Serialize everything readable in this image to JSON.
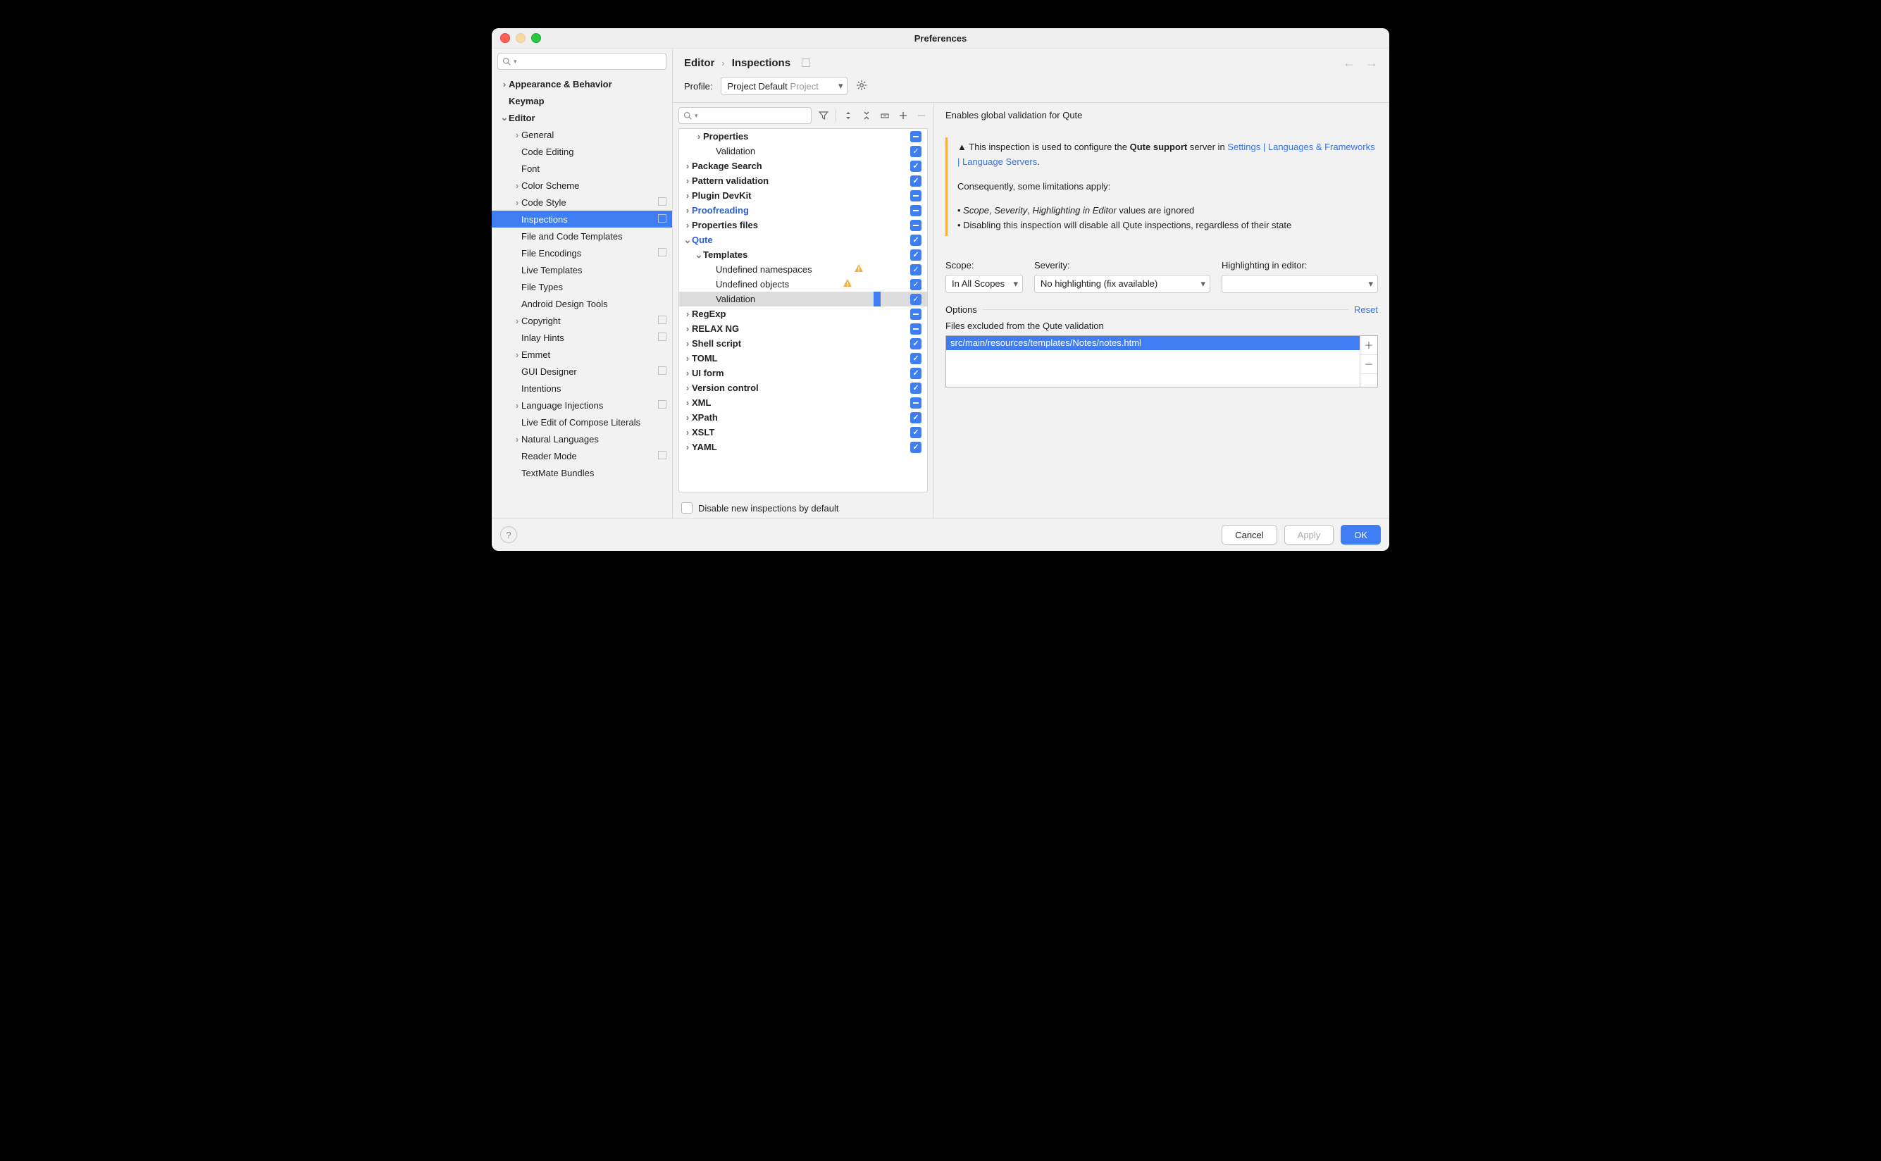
{
  "title": "Preferences",
  "breadcrumb": [
    "Editor",
    "Inspections"
  ],
  "profile_label": "Profile:",
  "profile_value": "Project Default",
  "profile_scope": "Project",
  "sidebar": [
    {
      "label": "Appearance & Behavior",
      "depth": 0,
      "arrow": "right",
      "bold": true
    },
    {
      "label": "Keymap",
      "depth": 0,
      "bold": true
    },
    {
      "label": "Editor",
      "depth": 0,
      "arrow": "down",
      "bold": true
    },
    {
      "label": "General",
      "depth": 1,
      "arrow": "right"
    },
    {
      "label": "Code Editing",
      "depth": 1
    },
    {
      "label": "Font",
      "depth": 1
    },
    {
      "label": "Color Scheme",
      "depth": 1,
      "arrow": "right"
    },
    {
      "label": "Code Style",
      "depth": 1,
      "arrow": "right",
      "dots": true
    },
    {
      "label": "Inspections",
      "depth": 1,
      "sel": true,
      "dots": true
    },
    {
      "label": "File and Code Templates",
      "depth": 1
    },
    {
      "label": "File Encodings",
      "depth": 1,
      "dots": true
    },
    {
      "label": "Live Templates",
      "depth": 1
    },
    {
      "label": "File Types",
      "depth": 1
    },
    {
      "label": "Android Design Tools",
      "depth": 1
    },
    {
      "label": "Copyright",
      "depth": 1,
      "arrow": "right",
      "dots": true
    },
    {
      "label": "Inlay Hints",
      "depth": 1,
      "dots": true
    },
    {
      "label": "Emmet",
      "depth": 1,
      "arrow": "right"
    },
    {
      "label": "GUI Designer",
      "depth": 1,
      "dots": true
    },
    {
      "label": "Intentions",
      "depth": 1
    },
    {
      "label": "Language Injections",
      "depth": 1,
      "arrow": "right",
      "dots": true
    },
    {
      "label": "Live Edit of Compose Literals",
      "depth": 1
    },
    {
      "label": "Natural Languages",
      "depth": 1,
      "arrow": "right"
    },
    {
      "label": "Reader Mode",
      "depth": 1,
      "dots": true
    },
    {
      "label": "TextMate Bundles",
      "depth": 1
    }
  ],
  "inspections": [
    {
      "label": "Properties",
      "depth": 1,
      "arrow": "right",
      "bold": true,
      "state": "mix"
    },
    {
      "label": "Validation",
      "depth": 2,
      "state": "on"
    },
    {
      "label": "Package Search",
      "depth": 0,
      "arrow": "right",
      "bold": true,
      "state": "on"
    },
    {
      "label": "Pattern validation",
      "depth": 0,
      "arrow": "right",
      "bold": true,
      "state": "on"
    },
    {
      "label": "Plugin DevKit",
      "depth": 0,
      "arrow": "right",
      "bold": true,
      "state": "mix"
    },
    {
      "label": "Proofreading",
      "depth": 0,
      "arrow": "right",
      "bold": true,
      "blue": true,
      "state": "mix"
    },
    {
      "label": "Properties files",
      "depth": 0,
      "arrow": "right",
      "bold": true,
      "state": "mix"
    },
    {
      "label": "Qute",
      "depth": 0,
      "arrow": "down",
      "bold": true,
      "blue": true,
      "state": "on"
    },
    {
      "label": "Templates",
      "depth": 1,
      "arrow": "down",
      "bold": true,
      "state": "on"
    },
    {
      "label": "Undefined namespaces",
      "depth": 2,
      "state": "on",
      "warn": true
    },
    {
      "label": "Undefined objects",
      "depth": 2,
      "state": "on",
      "warn": true
    },
    {
      "label": "Validation",
      "depth": 2,
      "state": "on",
      "sel": true
    },
    {
      "label": "RegExp",
      "depth": 0,
      "arrow": "right",
      "bold": true,
      "state": "mix"
    },
    {
      "label": "RELAX NG",
      "depth": 0,
      "arrow": "right",
      "bold": true,
      "state": "mix"
    },
    {
      "label": "Shell script",
      "depth": 0,
      "arrow": "right",
      "bold": true,
      "state": "on"
    },
    {
      "label": "TOML",
      "depth": 0,
      "arrow": "right",
      "bold": true,
      "state": "on"
    },
    {
      "label": "UI form",
      "depth": 0,
      "arrow": "right",
      "bold": true,
      "state": "on"
    },
    {
      "label": "Version control",
      "depth": 0,
      "arrow": "right",
      "bold": true,
      "state": "on"
    },
    {
      "label": "XML",
      "depth": 0,
      "arrow": "right",
      "bold": true,
      "state": "mix"
    },
    {
      "label": "XPath",
      "depth": 0,
      "arrow": "right",
      "bold": true,
      "state": "on"
    },
    {
      "label": "XSLT",
      "depth": 0,
      "arrow": "right",
      "bold": true,
      "state": "on"
    },
    {
      "label": "YAML",
      "depth": 0,
      "arrow": "right",
      "bold": true,
      "state": "on"
    }
  ],
  "disable_new": "Disable new inspections by default",
  "desc_title": "Enables global validation for Qute",
  "note_warn": "This inspection is used to configure the ",
  "note_bold1": "Qute support",
  "note_after1": " server in ",
  "note_link": "Settings | Languages & Frameworks | Language Servers",
  "note_p2": "Consequently, some limitations apply:",
  "note_b1_a": "Scope",
  "note_b1_b": "Severity",
  "note_b1_c": "Highlighting in Editor",
  "note_b1_tail": " values are ignored",
  "note_b2": "Disabling this inspection will disable all Qute inspections, regardless of their state",
  "scope_l": "Scope:",
  "scope_v": "In All Scopes",
  "sev_l": "Severity:",
  "sev_v": "No highlighting (fix available)",
  "hi_l": "Highlighting in editor:",
  "options": "Options",
  "reset": "Reset",
  "excluded_l": "Files excluded from the Qute validation",
  "excluded_row": "src/main/resources/templates/Notes/notes.html",
  "cancel": "Cancel",
  "apply": "Apply",
  "ok": "OK"
}
